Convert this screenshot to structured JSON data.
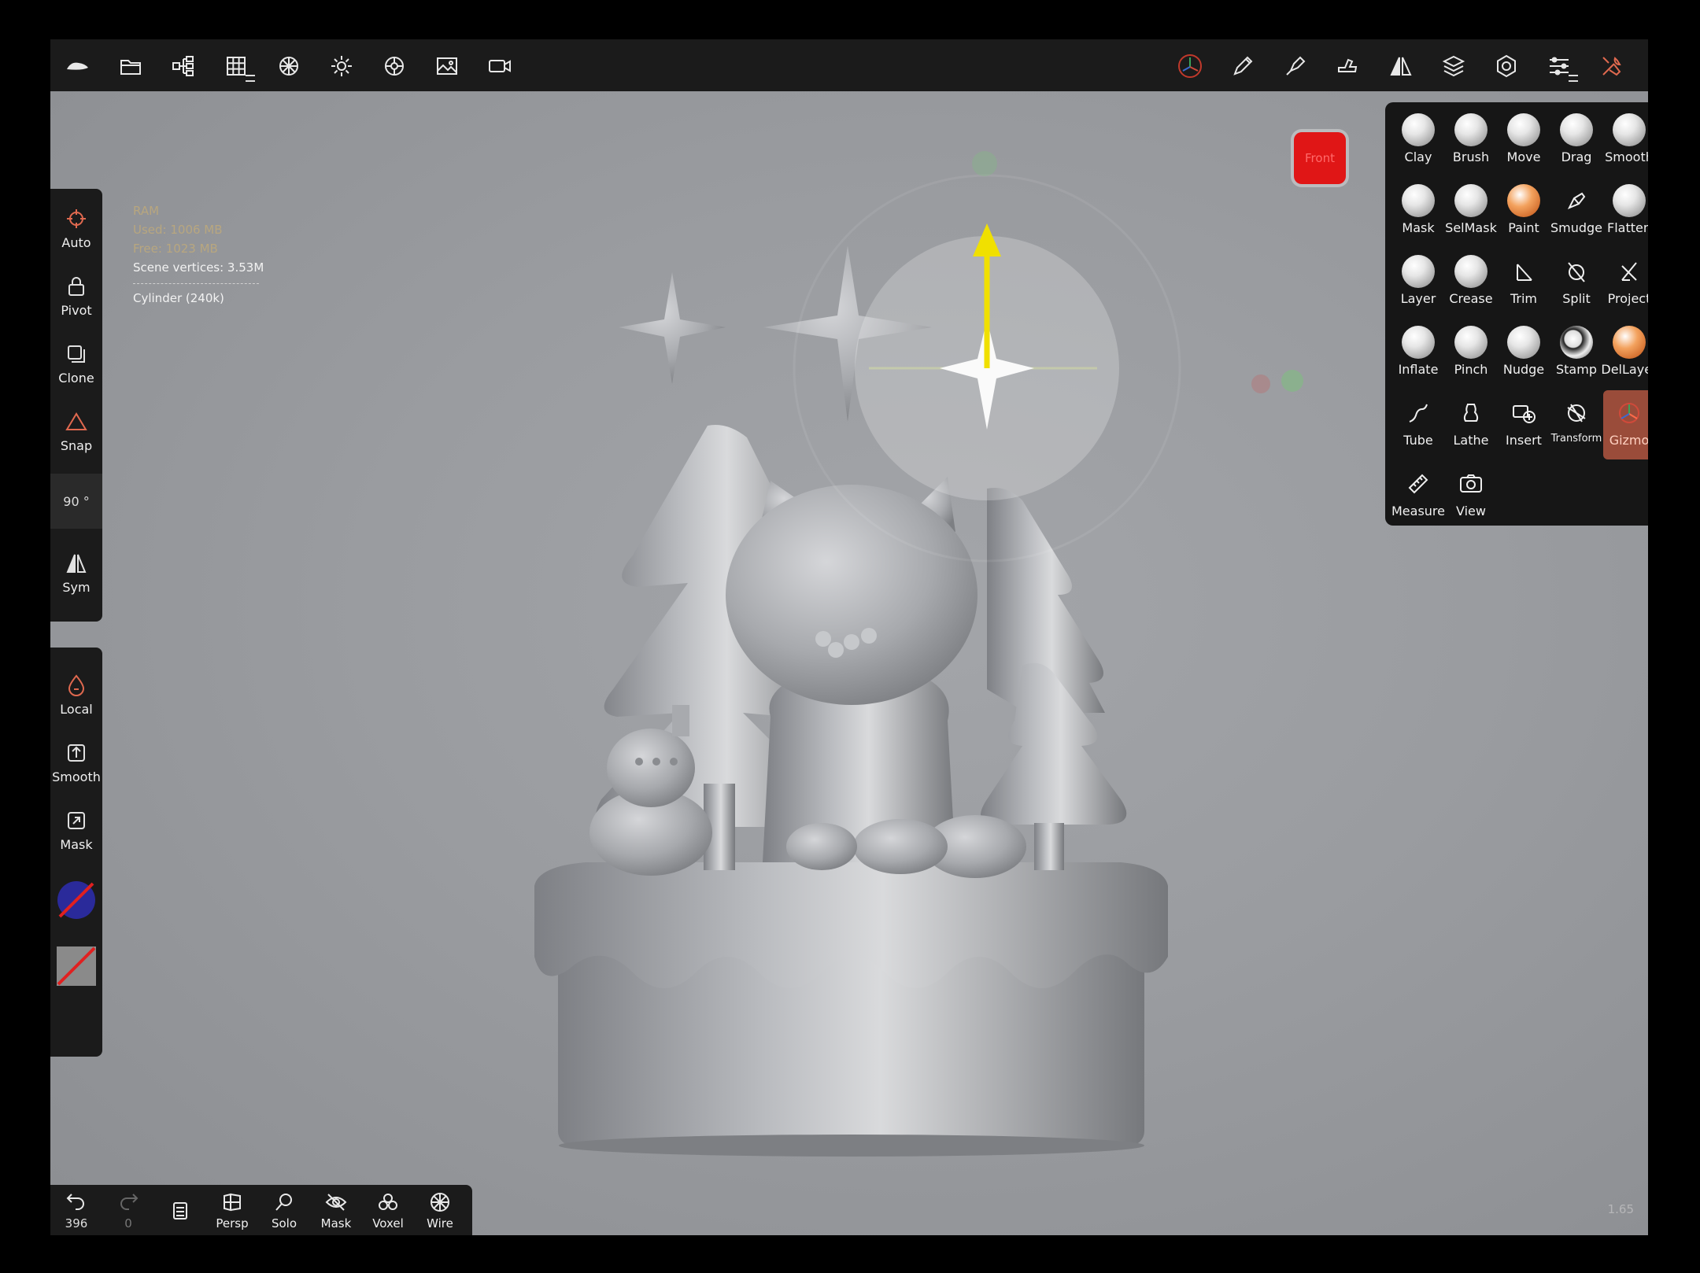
{
  "top_toolbar": {
    "left_icons": [
      "app-logo-icon",
      "folder-icon",
      "scene-tree-icon",
      "grid-icon",
      "material-icon",
      "light-icon",
      "filter-icon",
      "background-icon",
      "camera-icon"
    ],
    "right_icons": [
      "gizmo-axis-icon",
      "pen-icon",
      "brush-pen-icon",
      "smudge-tool-icon",
      "symmetry-icon",
      "layers-icon",
      "settings-icon",
      "sliders-icon",
      "tools-icon"
    ]
  },
  "info": {
    "ram": "RAM",
    "used": "Used: 1006 MB",
    "free": "Free: 1023 MB",
    "vertices": "Scene vertices: 3.53M",
    "object": "Cylinder (240k)"
  },
  "left_panel": {
    "auto": "Auto",
    "pivot": "Pivot",
    "clone": "Clone",
    "snap": "Snap",
    "angle": "90 °",
    "sym": "Sym",
    "local": "Local",
    "smooth": "Smooth",
    "mask": "Mask"
  },
  "view_cube": {
    "label": "Front",
    "color": "#e01616"
  },
  "tools": {
    "clay": "Clay",
    "brush": "Brush",
    "move": "Move",
    "drag": "Drag",
    "smooth": "Smooth",
    "mask": "Mask",
    "selmask": "SelMask",
    "paint": "Paint",
    "smudge": "Smudge",
    "flatten": "Flatten",
    "layer": "Layer",
    "crease": "Crease",
    "trim": "Trim",
    "split": "Split",
    "project": "Project",
    "inflate": "Inflate",
    "pinch": "Pinch",
    "nudge": "Nudge",
    "stamp": "Stamp",
    "dellayer": "DelLayer",
    "tube": "Tube",
    "lathe": "Lathe",
    "insert": "Insert",
    "transform": "Transform",
    "gizmo": "Gizmo",
    "measure": "Measure",
    "view": "View",
    "active": "Gizmo",
    "active_color": "#9a4c3a"
  },
  "bottom_bar": {
    "undo_count": "396",
    "redo_count": "0",
    "persp": "Persp",
    "solo": "Solo",
    "mask": "Mask",
    "voxel": "Voxel",
    "wire": "Wire"
  },
  "version": "1.65"
}
